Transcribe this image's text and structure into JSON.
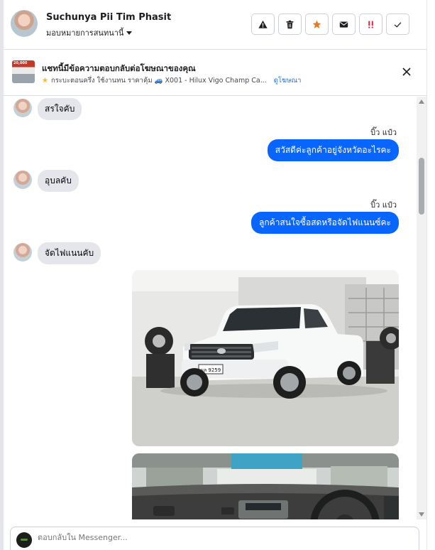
{
  "header": {
    "name": "Suchunya Pii Tim Phasit",
    "assign_label": "มอบหมายการสนทนานี้",
    "actions": [
      "warning-icon",
      "trash-icon",
      "star-icon",
      "envelope-icon",
      "important-icon",
      "check-icon"
    ],
    "colors": {
      "star": "#e87a1e",
      "important": "#e41e3f"
    }
  },
  "ad": {
    "title": "แชทนี้มีข้อความตอบกลับต่อโฆษณาของคุณ",
    "thumb_tag": "20,000",
    "subtitle": "กระบะตอนครึ่ง ใช้งานทน ราคาคุ้ม 🚙 X001 - Hilux Vigo Champ Ca...",
    "link": "ดูโฆษณา"
  },
  "messages": [
    {
      "direction": "in",
      "text": "สรใจคับ"
    },
    {
      "direction": "out",
      "sender": "บิ๊ว แป๋ว",
      "text": "สวัสดีค่ะลูกค้าอยู่จังหวัดอะไรคะ"
    },
    {
      "direction": "in",
      "text": "อุบลคับ"
    },
    {
      "direction": "out",
      "sender": "บิ๊ว แป๋ว",
      "text": "ลูกค้าสนใจซื้อสดหรือจัดไฟแนนซ์คะ"
    },
    {
      "direction": "in",
      "text": "จัดไฟแนนคับ"
    }
  ],
  "photos": {
    "plate": "ผล 9259"
  },
  "composer": {
    "placeholder": "ตอบกลับใน Messenger..."
  },
  "colors": {
    "outgoing_bubble": "#0866ff",
    "incoming_bubble": "#e4e6eb",
    "link": "#216fdb"
  }
}
